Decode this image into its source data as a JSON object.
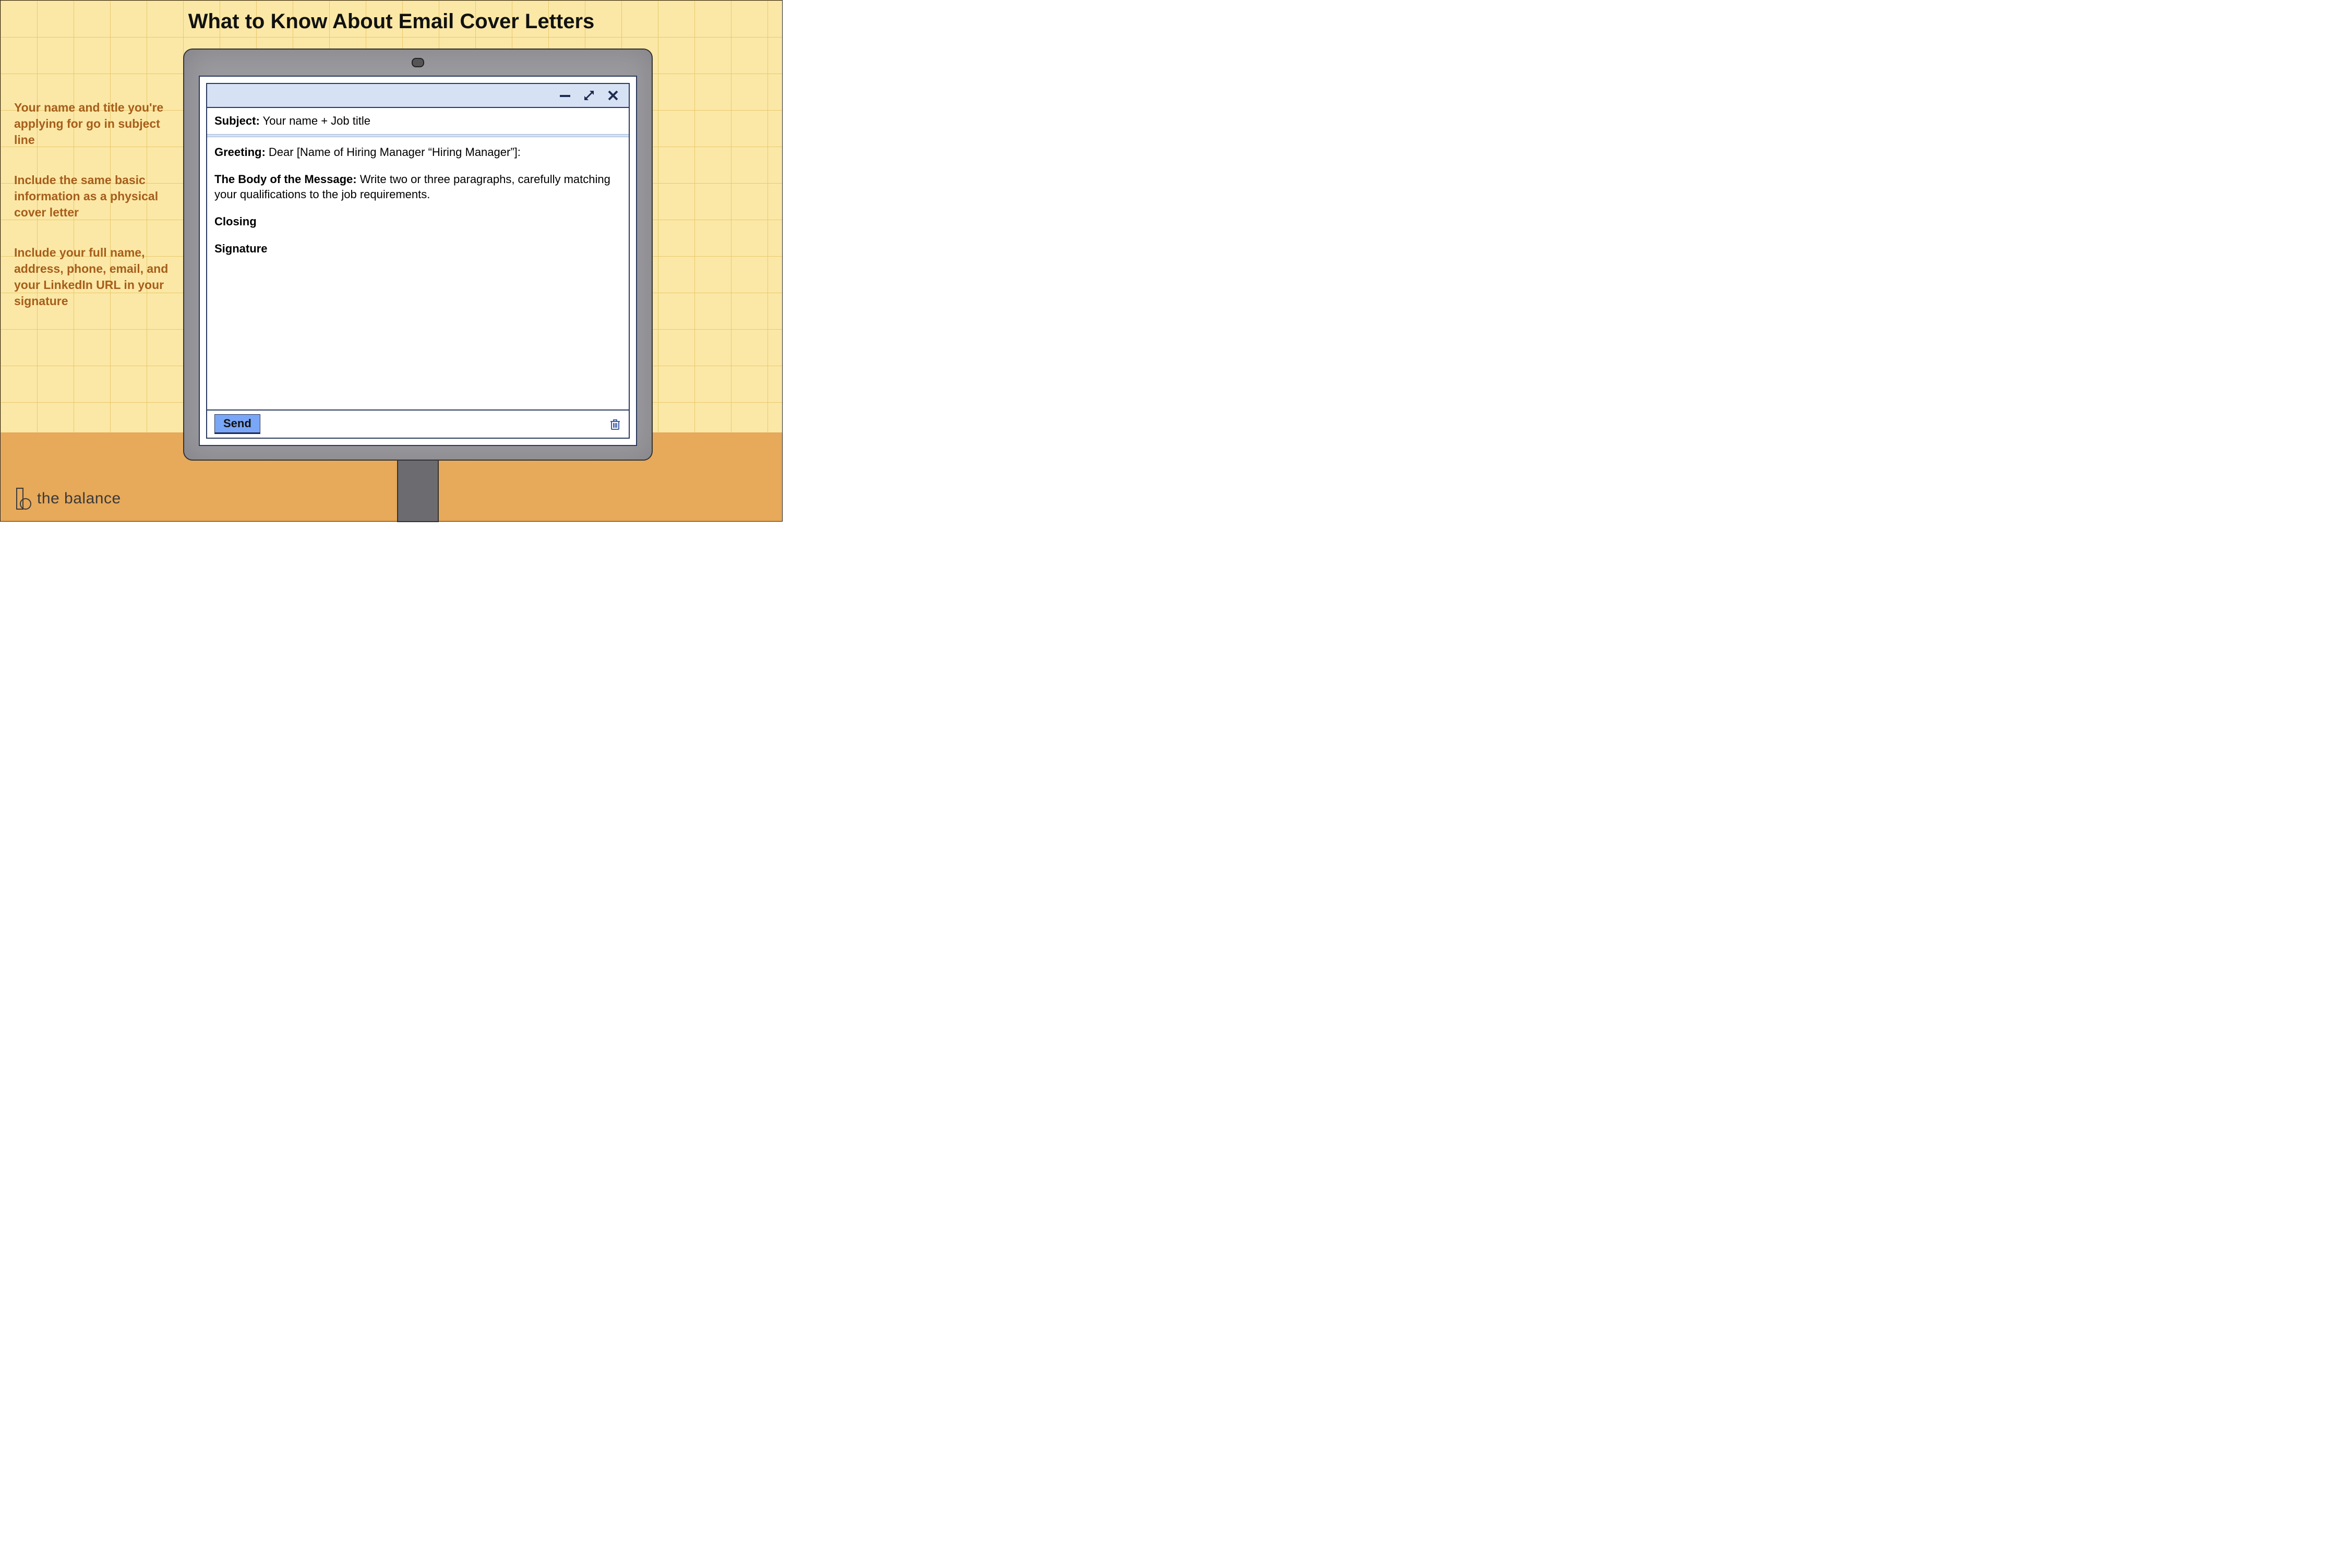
{
  "title": "What to Know About Email Cover Letters",
  "callouts": [
    "Your name and title you're applying for go in subject line",
    "Include the same basic information as a physical cover letter",
    "Include your full name, address, phone, email, and your LinkedIn URL in your signature"
  ],
  "email": {
    "subject_label": "Subject:",
    "subject_value": " Your name + Job title",
    "greeting_label": "Greeting:",
    "greeting_value": " Dear [Name of Hiring Manager “Hiring Manager”]:",
    "body_label": "The Body of the Message:",
    "body_value": " Write two or three paragraphs, carefully matching your qualifications to the job requirements.",
    "closing_label": "Closing",
    "signature_label": "Signature",
    "send_label": "Send"
  },
  "logo_text": "the balance"
}
